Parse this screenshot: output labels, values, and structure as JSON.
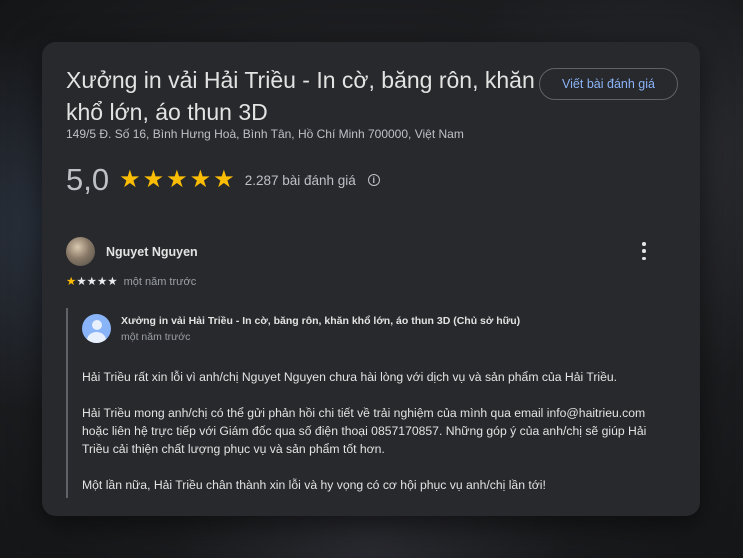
{
  "place": {
    "title": "Xưởng in vải Hải Triều - In cờ, băng rôn, khăn khổ lớn, áo thun 3D",
    "address": "149/5 Đ. Số 16, Bình Hưng Hoà, Bình Tân, Hồ Chí Minh 700000, Việt Nam",
    "write_review_label": "Viết bài đánh giá",
    "rating": "5,0",
    "rating_stars": 5,
    "review_count": "2.287 bài đánh giá",
    "info_icon": "info-icon"
  },
  "review": {
    "author": "Nguyet Nguyen",
    "stars": 1,
    "max_stars": 5,
    "time": "một năm trước",
    "more_icon": "more-vert-icon"
  },
  "reply": {
    "owner": "Xưởng in vải Hải Triều - In cờ, băng rôn, khăn khổ lớn, áo thun 3D (Chủ sở hữu)",
    "time": "một năm trước",
    "paragraphs": [
      "Hải Triều rất xin lỗi vì anh/chị Nguyet Nguyen chưa hài lòng với dịch vụ và sản phẩm của Hải Triều.",
      "Hải Triều mong anh/chị có thể gửi phản hồi chi tiết về trải nghiệm của mình qua email info@haitrieu.com hoặc liên hệ trực tiếp với Giám đốc qua số điện thoại 0857170857. Những góp ý của anh/chị sẽ giúp Hải Triều cải thiện chất lượng phục vụ và sản phẩm tốt hơn.",
      "Một lần nữa, Hải Triều chân thành xin lỗi và hy vọng có cơ hội phục vụ anh/chị lần tới!"
    ]
  },
  "colors": {
    "star": "#fbbc04",
    "link": "#8ab4f8",
    "card": "#28292c"
  }
}
